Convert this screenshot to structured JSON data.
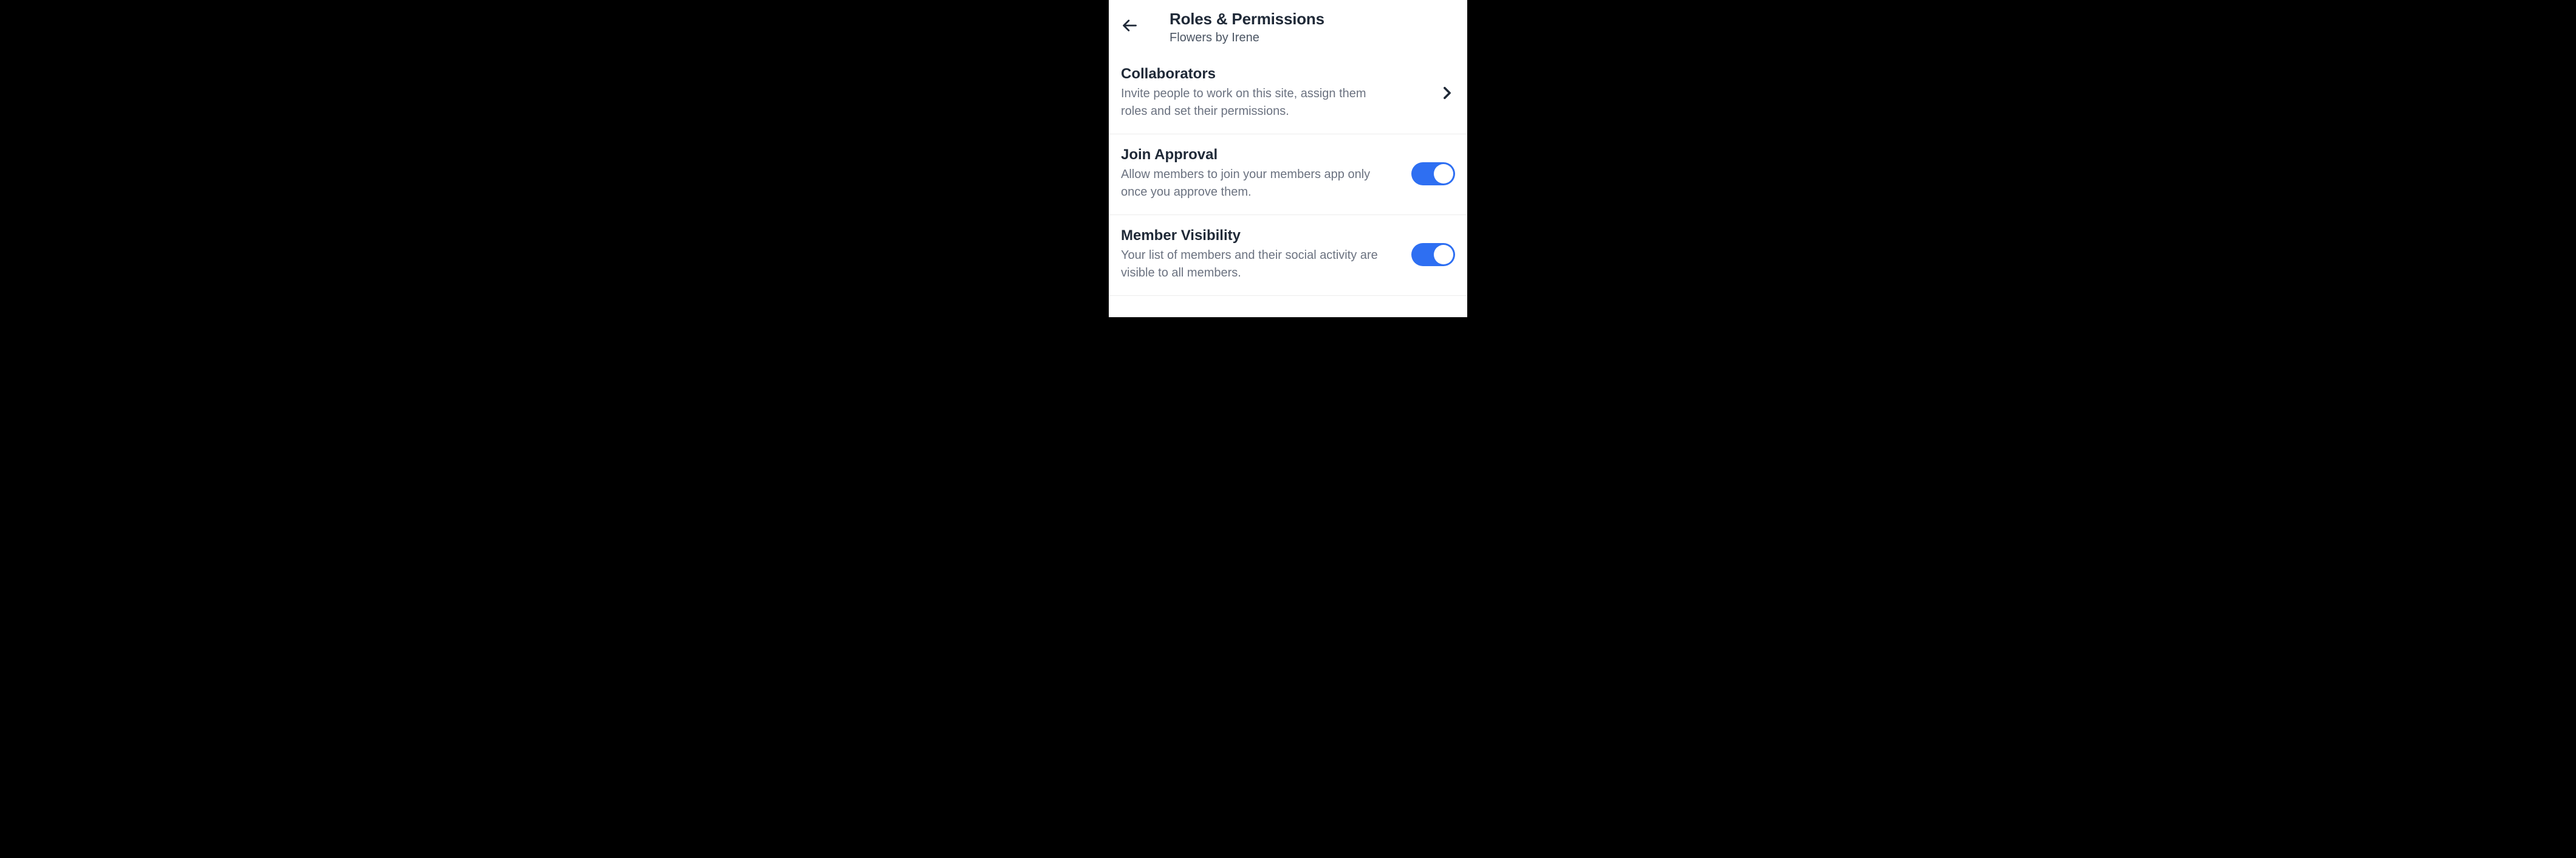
{
  "header": {
    "title": "Roles & Permissions",
    "subtitle": "Flowers by Irene"
  },
  "sections": {
    "collaborators": {
      "title": "Collaborators",
      "desc": "Invite people to work on this site, assign them roles and set their permissions."
    },
    "join_approval": {
      "title": "Join Approval",
      "desc": "Allow members to join your members app only once you approve them.",
      "toggle_on": true
    },
    "member_visibility": {
      "title": "Member Visibility",
      "desc": "Your list of members and their social activity are visible to all members.",
      "toggle_on": true
    }
  },
  "colors": {
    "toggle_active": "#2e6ff2"
  }
}
